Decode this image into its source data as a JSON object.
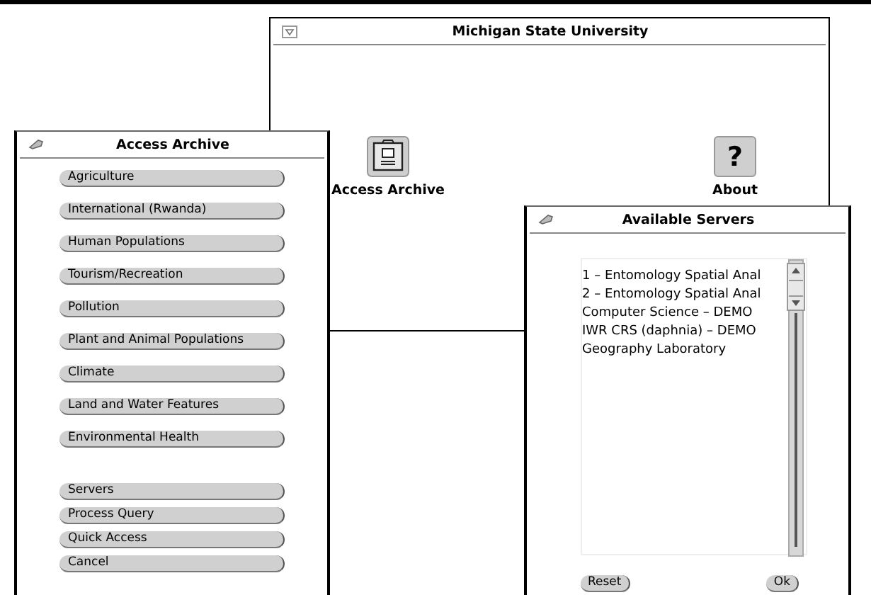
{
  "main_window": {
    "title": "Michigan State University",
    "icons": [
      {
        "kind": "archive",
        "label": "Access Archive"
      },
      {
        "kind": "glyph",
        "glyph": "?",
        "label": "About"
      }
    ]
  },
  "archive_window": {
    "title": "Access Archive",
    "topics": [
      "Agriculture",
      "International (Rwanda)",
      "Human Populations",
      "Tourism/Recreation",
      "Pollution",
      "Plant and Animal Populations",
      "Climate",
      "Land and Water Features",
      "Environmental Health"
    ],
    "actions": [
      "Servers",
      "Process Query",
      "Quick Access",
      "Cancel"
    ]
  },
  "servers_window": {
    "title": "Available Servers",
    "servers": [
      "1 – Entomology Spatial Anal",
      "2 – Entomology Spatial Anal",
      "Computer Science – DEMO",
      "IWR CRS (daphnia) – DEMO",
      "Geography Laboratory"
    ],
    "buttons": [
      "Reset",
      "Ok"
    ]
  }
}
